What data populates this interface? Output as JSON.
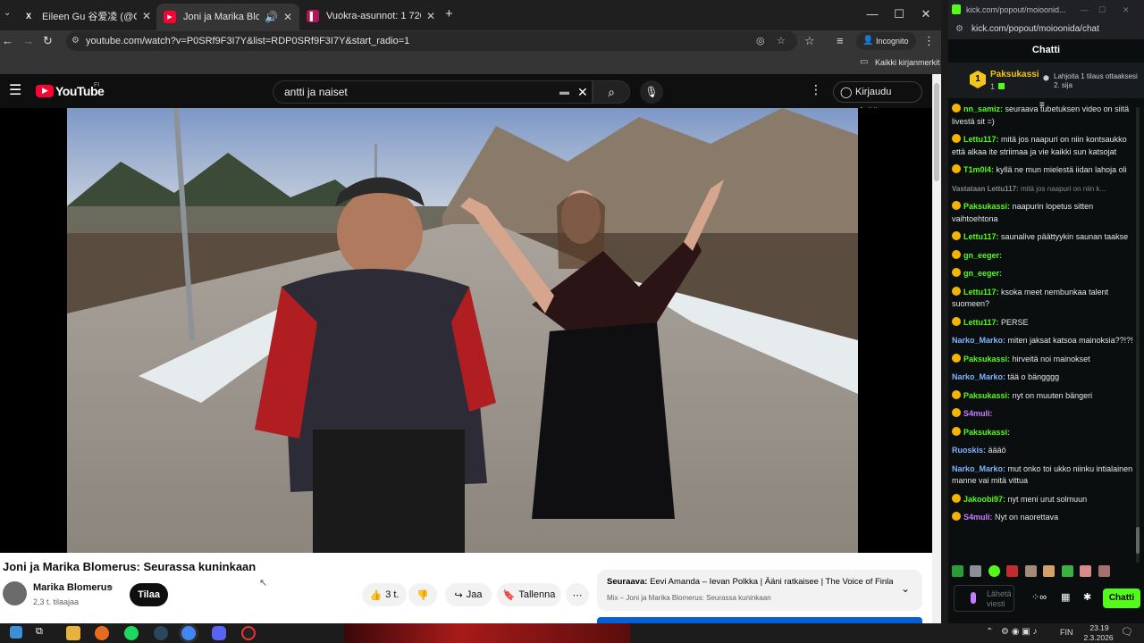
{
  "browser": {
    "tabs": [
      {
        "title": "Eileen Gu 谷爱凌 (@GoEileenGu",
        "favicon": "X"
      },
      {
        "title": "Joni ja Marika Blomerus: Se",
        "favicon": "▶"
      },
      {
        "title": "Vuokra-asunnot: 1 720 kpl - Vu",
        "favicon": "▌"
      }
    ],
    "url": "youtube.com/watch?v=P0SRf9F3I7Y&list=RDP0SRf9F3I7Y&start_radio=1",
    "incognito_label": "Incognito",
    "bookmarks_label": "Kaikki kirjanmerkit"
  },
  "youtube": {
    "logo_text": "YouTube",
    "logo_region": "FI",
    "search_value": "antti ja naiset",
    "signin_label": "Kirjaudu sisään",
    "video_title": "Joni ja Marika Blomerus: Seurassa kuninkaan",
    "channel_name": "Marika Blomerus",
    "subscribers": "2,3 t. tilaajaa",
    "subscribe_label": "Tilaa",
    "like_count": "3 t.",
    "share_label": "Jaa",
    "save_label": "Tallenna",
    "next_label": "Seuraava:",
    "next_title": "Eevi Amanda – Ievan Polkka | Ääni ratkaisee | The Voice of Finla...",
    "next_sub": "Mix – Joni ja Marika Blomerus: Seurassa kuninkaan"
  },
  "kick": {
    "window_title": "kick.com/popout/moioonid...",
    "url": "kick.com/popout/moioonida/chat",
    "chat_title": "Chatti",
    "pinned_user": "Paksukassi",
    "pinned_count": "1",
    "pinned_rank": "1",
    "pinned_text": "Lahjoita 1 tilaus ottaaksesi 2. sija",
    "messages": [
      {
        "user": "nn_samiz:",
        "text": "seuraava tubetuksen video on siitä livestä sit =)",
        "color": "#53fc18"
      },
      {
        "user": "Lettu117:",
        "text": "mitä jos naapuri on niin kontsaukko että alkaa ite striimaa ja vie kaikki sun katsojat",
        "color": "#53fc18"
      },
      {
        "user": "T1m0l4:",
        "text": "kyllä ne mun mielestä iidan lahoja oli",
        "color": "#53fc18"
      },
      {
        "user": "Vastataan Lettu117:",
        "text": "mitä jos naapuri on niin k...",
        "color": "#888888"
      },
      {
        "user": "Paksukassi:",
        "text": "naapurin lopetus sitten vaihtoehtona",
        "color": "#53fc18"
      },
      {
        "user": "Lettu117:",
        "text": "saunalive päättyykin saunan taakse",
        "color": "#53fc18"
      },
      {
        "user": "gn_eeger:",
        "text": "",
        "color": "#53fc18"
      },
      {
        "user": "gn_eeger:",
        "text": "",
        "color": "#53fc18"
      },
      {
        "user": "Lettu117:",
        "text": "ksoka meet nembunkaa talent suomeen?",
        "color": "#53fc18"
      },
      {
        "user": "Lettu117:",
        "text": "PERSE",
        "color": "#53fc18"
      },
      {
        "user": "Narko_Marko:",
        "text": "miten jaksat katsoa mainoksia??!?!",
        "color": "#7fb2ff"
      },
      {
        "user": "Paksukassi:",
        "text": "hirveitä noi mainokset",
        "color": "#53fc18"
      },
      {
        "user": "Narko_Marko:",
        "text": "tää o bängggg",
        "color": "#7fb2ff"
      },
      {
        "user": "Paksukassi:",
        "text": "nyt on muuten bängeri",
        "color": "#53fc18"
      },
      {
        "user": "S4muli:",
        "text": "",
        "color": "#c77dff"
      },
      {
        "user": "Paksukassi:",
        "text": "",
        "color": "#53fc18"
      },
      {
        "user": "Ruoskis:",
        "text": "äääö",
        "color": "#7fb2ff"
      },
      {
        "user": "Narko_Marko:",
        "text": "mut onko toi ukko niinku intialainen manne vai mitä vittua",
        "color": "#7fb2ff"
      },
      {
        "user": "Jakoobi97:",
        "text": "nyt meni urut solmuun",
        "color": "#53fc18"
      },
      {
        "user": "S4muli:",
        "text": "Nyt on naorettava",
        "color": "#c77dff"
      }
    ],
    "input_placeholder": "Lähetä viesti",
    "chat_button": "Chatti"
  },
  "taskbar": {
    "lang": "FIN",
    "time": "23.19",
    "date": "2.3.2026"
  }
}
